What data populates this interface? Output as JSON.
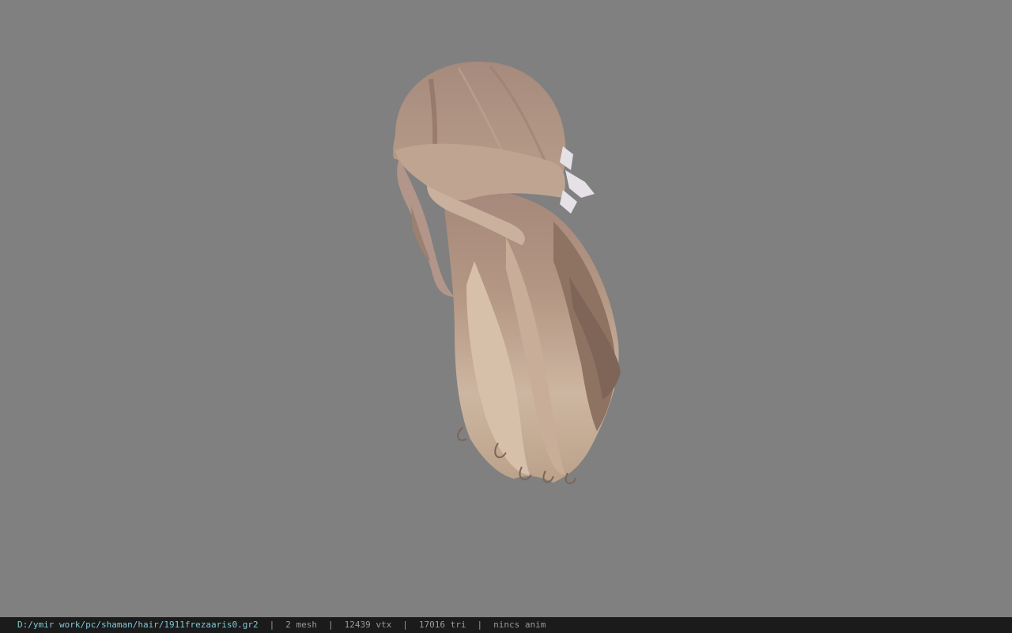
{
  "viewer": {
    "background_color": "#808080",
    "model": {
      "name": "hair-model",
      "colors": {
        "crown": "#a88a78",
        "strand_dark": "#8c705f",
        "strand_light": "#d8c2ad",
        "tips": "#c9b09a",
        "bow": "#e6e2e8"
      }
    }
  },
  "statusbar": {
    "path": "D:/ymir work/pc/shaman/hair/1911frezaaris0.gr2",
    "separator": "|",
    "mesh": "2 mesh",
    "vertices": "12439 vtx",
    "triangles": "17016 tri",
    "animation": "nincs anim"
  }
}
